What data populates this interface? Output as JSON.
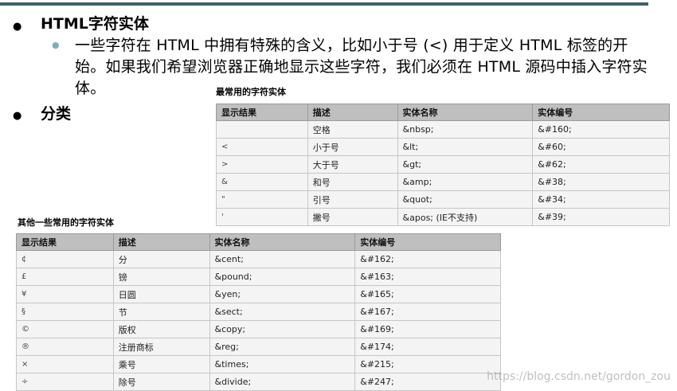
{
  "bullets": [
    {
      "text": "HTML字符实体"
    },
    {
      "text": "分类"
    }
  ],
  "sub_bullet": {
    "text": "一些字符在 HTML 中拥有特殊的含义，比如小于号 (<) 用于定义 HTML 标签的开始。如果我们希望浏览器正确地显示这些字符，我们必须在 HTML 源码中插入字符实体。"
  },
  "table_common": {
    "title": "最常用的字符实体",
    "headers": [
      "显示结果",
      "描述",
      "实体名称",
      "实体编号"
    ],
    "rows": [
      [
        " ",
        "空格",
        "&nbsp;",
        "&#160;"
      ],
      [
        "<",
        "小于号",
        "&lt;",
        "&#60;"
      ],
      [
        ">",
        "大于号",
        "&gt;",
        "&#62;"
      ],
      [
        "&",
        "和号",
        "&amp;",
        "&#38;"
      ],
      [
        "\"",
        "引号",
        "&quot;",
        "&#34;"
      ],
      [
        "'",
        "撇号",
        "&apos; (IE不支持)",
        "&#39;"
      ]
    ]
  },
  "table_other": {
    "title": "其他一些常用的字符实体",
    "headers": [
      "显示结果",
      "描述",
      "实体名称",
      "实体编号"
    ],
    "rows": [
      [
        "¢",
        "分",
        "&cent;",
        "&#162;"
      ],
      [
        "£",
        "镑",
        "&pound;",
        "&#163;"
      ],
      [
        "¥",
        "日圆",
        "&yen;",
        "&#165;"
      ],
      [
        "§",
        "节",
        "&sect;",
        "&#167;"
      ],
      [
        "©",
        "版权",
        "&copy;",
        "&#169;"
      ],
      [
        "®",
        "注册商标",
        "&reg;",
        "&#174;"
      ],
      [
        "×",
        "乘号",
        "&times;",
        "&#215;"
      ],
      [
        "÷",
        "除号",
        "&divide;",
        "&#247;"
      ]
    ]
  },
  "watermark": "https://blog.csdn.net/gordon_zou"
}
